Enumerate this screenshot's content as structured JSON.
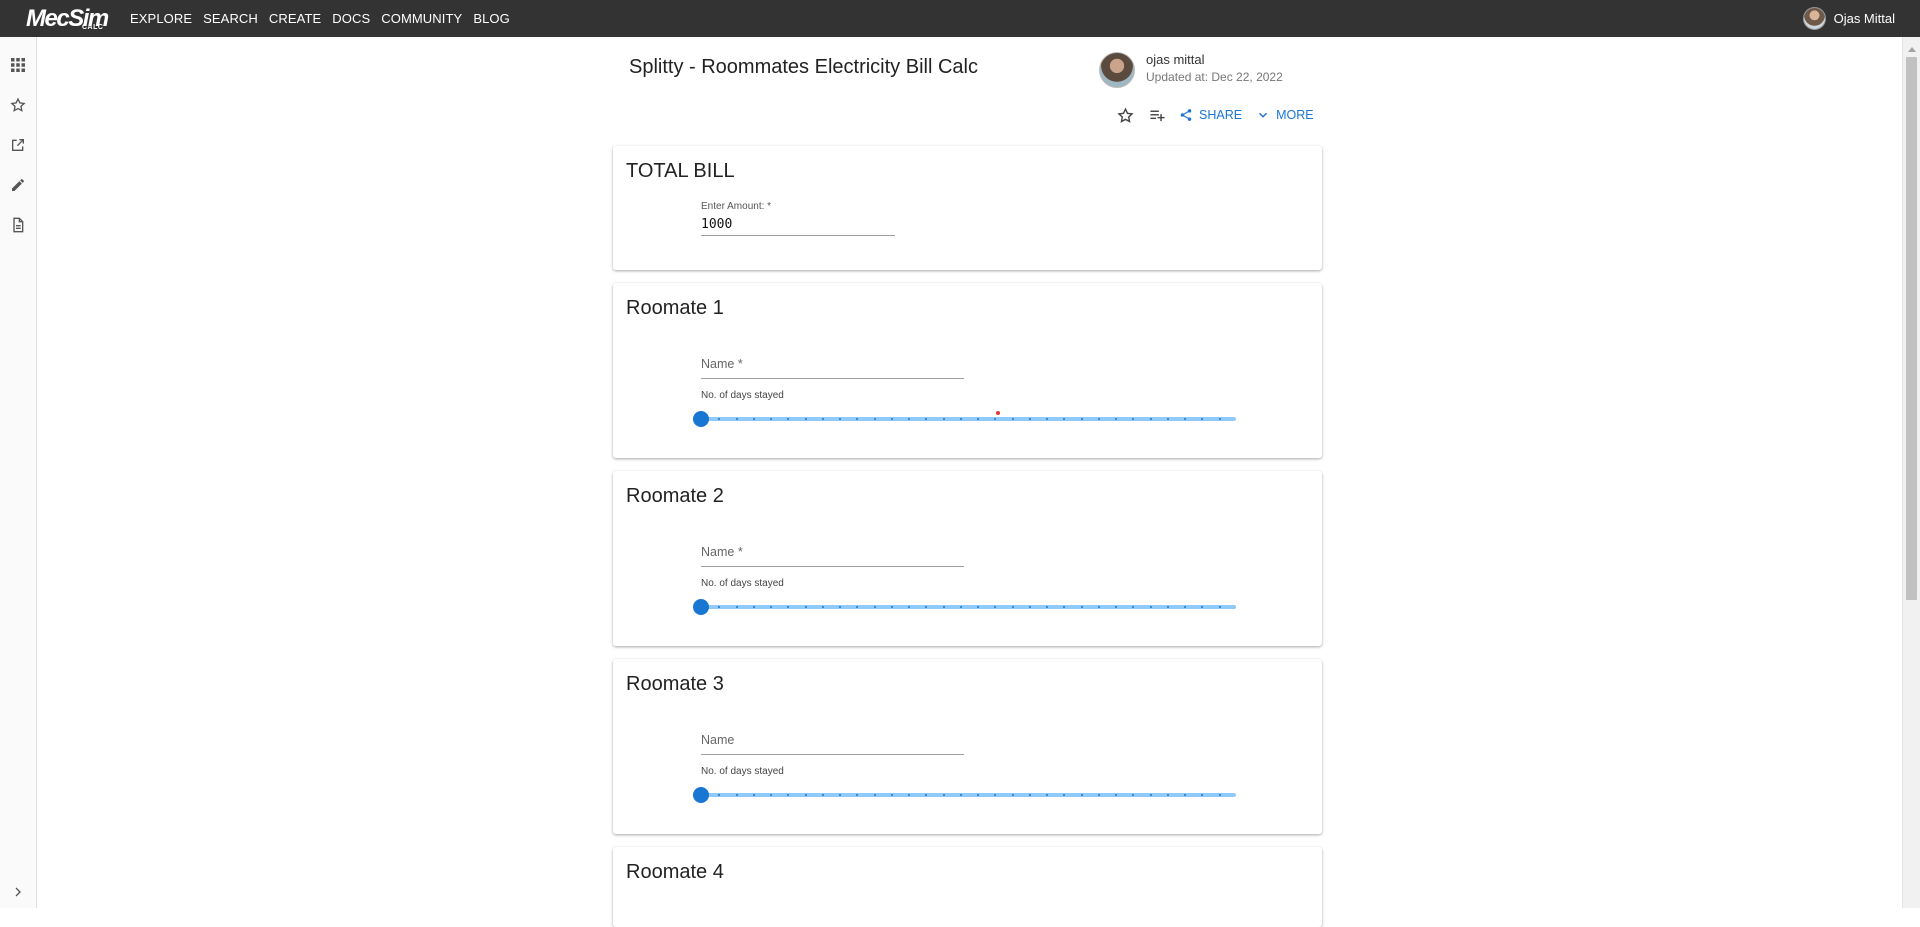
{
  "brand": {
    "logo_main": "MecSim",
    "logo_sub": "CALC"
  },
  "nav": {
    "items": [
      {
        "label": "EXPLORE"
      },
      {
        "label": "SEARCH"
      },
      {
        "label": "CREATE"
      },
      {
        "label": "DOCS"
      },
      {
        "label": "COMMUNITY"
      },
      {
        "label": "BLOG"
      }
    ]
  },
  "user": {
    "name": "Ojas Mittal"
  },
  "rail": {
    "icons": [
      "apps-grid-icon",
      "star-outline-icon",
      "open-in-new-icon",
      "edit-pencil-icon",
      "document-icon",
      "chevron-right-icon"
    ]
  },
  "page": {
    "title": "Splitty - Roommates Electricity Bill Calc",
    "author": "ojas mittal",
    "updated": "Updated at: Dec 22, 2022"
  },
  "actions": {
    "share_label": "SHARE",
    "more_label": "MORE"
  },
  "total_bill": {
    "title": "TOTAL BILL",
    "amount_label": "Enter Amount: *",
    "amount_value": "1000"
  },
  "roommates": [
    {
      "title": "Roomate 1",
      "name_placeholder": "Name *",
      "days_label": "No. of days stayed",
      "days_value": 0
    },
    {
      "title": "Roomate 2",
      "name_placeholder": "Name *",
      "days_label": "No. of days stayed",
      "days_value": 0
    },
    {
      "title": "Roomate 3",
      "name_placeholder": "Name",
      "days_label": "No. of days stayed",
      "days_value": 0
    },
    {
      "title": "Roomate 4"
    }
  ],
  "colors": {
    "topbar": "#333333",
    "accent": "#1976d2",
    "slider_track": "#90caf9"
  }
}
